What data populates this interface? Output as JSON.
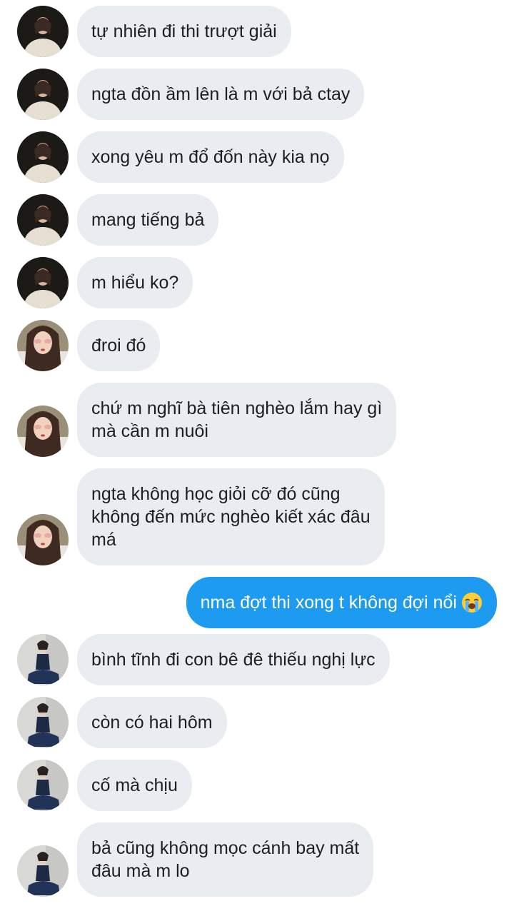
{
  "messages": [
    {
      "text": "tự nhiên đi thi trượt giải",
      "sender": "contact-a"
    },
    {
      "text": "ngta đồn ầm lên là m với bả ctay",
      "sender": "contact-a"
    },
    {
      "text": "xong yêu m đổ đốn này kia nọ",
      "sender": "contact-a"
    },
    {
      "text": "mang tiếng bả",
      "sender": "contact-a"
    },
    {
      "text": "m hiểu ko?",
      "sender": "contact-a"
    },
    {
      "text": "đroi đó",
      "sender": "contact-b"
    },
    {
      "text": "chứ m nghĩ bà tiên nghèo lắm hay gì\nmà cần m nuôi",
      "sender": "contact-b"
    },
    {
      "text": "ngta không học giỏi cỡ đó cũng\nkhông đến mức nghèo kiết xác đâu\nmá",
      "sender": "contact-b"
    },
    {
      "text": "nma đợt thi xong t không đợi nổi",
      "sender": "me",
      "emoji": "loudly-crying-face-icon"
    },
    {
      "text": "bình tĩnh đi con bê đê thiếu nghị lực",
      "sender": "contact-c"
    },
    {
      "text": "còn có hai hôm",
      "sender": "contact-c"
    },
    {
      "text": "cố mà chịu",
      "sender": "contact-c"
    },
    {
      "text": "bả cũng không mọc cánh bay mất\nđâu mà m lo",
      "sender": "contact-c"
    }
  ],
  "colors": {
    "received_bubble": "#e9ecf0",
    "sent_bubble": "#1d9bf0",
    "received_text": "#1c1e21",
    "sent_text": "#ffffff"
  }
}
